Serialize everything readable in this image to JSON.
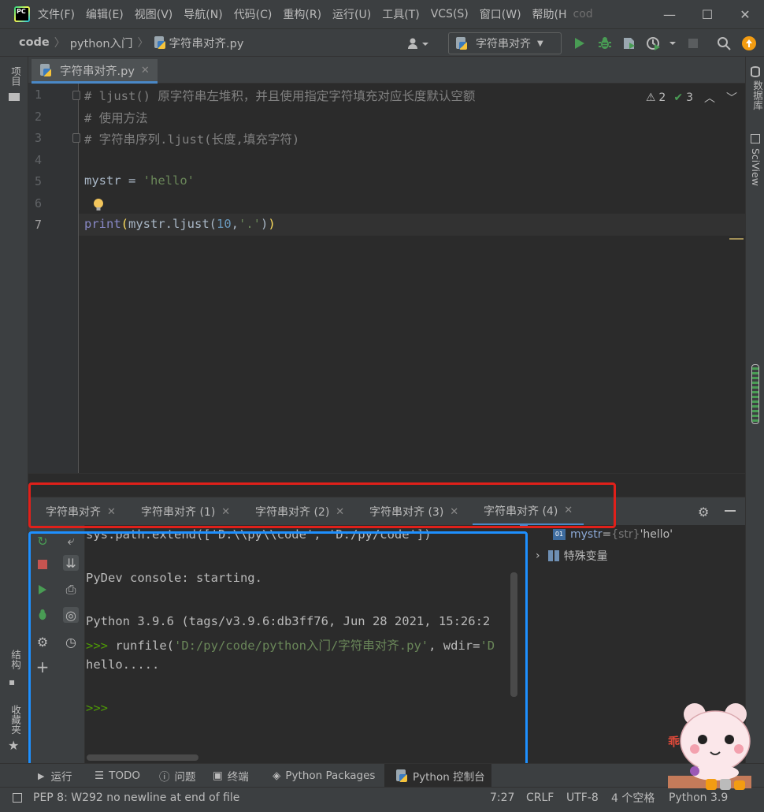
{
  "menubar": {
    "items": [
      "文件(F)",
      "编辑(E)",
      "视图(V)",
      "导航(N)",
      "代码(C)",
      "重构(R)",
      "运行(U)",
      "工具(T)",
      "VCS(S)",
      "窗口(W)",
      "帮助(H"
    ],
    "project_hint": "cod"
  },
  "navbar": {
    "breadcrumbs": [
      "code",
      "python入门",
      "字符串对齐.py"
    ],
    "run_config": "字符串对齐"
  },
  "left_strip": {
    "project": "项目",
    "structure": "结构",
    "favorites": "收藏夹"
  },
  "right_strip": {
    "database": "数据库",
    "sciview": "SciView"
  },
  "editor_tab": {
    "label": "字符串对齐.py"
  },
  "inspections": {
    "warnings": "2",
    "ok": "3"
  },
  "editor": {
    "line_numbers": [
      "1",
      "2",
      "3",
      "4",
      "5",
      "6",
      "7"
    ],
    "lines": {
      "l1": "# ljust() 原字符串左堆积，并且使用指定字符填充对应长度默认空额",
      "l2": "# 使用方法",
      "l3": "# 字符串序列.ljust(长度,填充字符)",
      "l5_var": "mystr",
      "l5_op": " = ",
      "l5_str": "'hello'",
      "l7_fn": "print",
      "l7_open": "(",
      "l7_mid": "mystr.ljust(",
      "l7_num": "10",
      "l7_comma": ",",
      "l7_str": "'.'",
      "l7_close1": ")",
      "l7_close2": ")"
    }
  },
  "tool_tabs": [
    "字符串对齐",
    "字符串对齐 (1)",
    "字符串对齐 (2)",
    "字符串对齐 (3)",
    "字符串对齐 (4)"
  ],
  "console": {
    "lines": {
      "sys_path": "sys.path.extend(['D:\\\\py\\\\code', 'D:/py/code'])",
      "starting": "PyDev console: starting.",
      "python_version": "Python 3.9.6 (tags/v3.9.6:db3ff76, Jun 28 2021, 15:26:2",
      "prompt1": ">>> ",
      "runfile_a": "runfile(",
      "runfile_b": "'D:/py/code/python入门/字符串对齐.py'",
      "runfile_c": ", wdir=",
      "runfile_d": "'D",
      "output": "hello.....",
      "prompt2": ">>>"
    }
  },
  "variables": {
    "mystr_name": "mystr",
    "mystr_eq": " = ",
    "mystr_type": "{str}",
    "mystr_value": " 'hello'",
    "special": "特殊变量"
  },
  "bottom_tabs": [
    "运行",
    "TODO",
    "问题",
    "终端",
    "Python Packages",
    "Python 控制台"
  ],
  "status": {
    "message": "PEP 8: W292 no newline at end of file",
    "position": "7:27",
    "line_sep": "CRLF",
    "encoding": "UTF-8",
    "indent": "4 个空格",
    "interpreter": "Python 3.9"
  },
  "mascot_text": "乖",
  "colors": {
    "accent": "#4a88c7",
    "red_box": "#e0201a",
    "blue_box": "#1e90ff",
    "run_green": "#499c54"
  }
}
